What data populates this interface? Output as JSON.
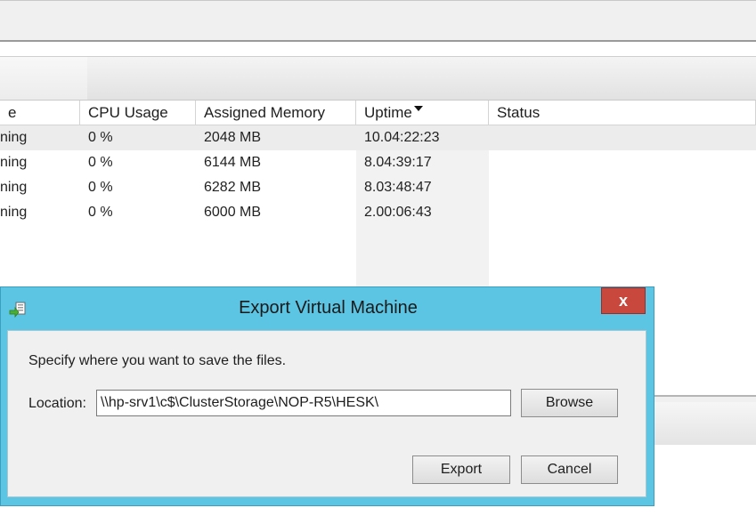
{
  "vm_list": {
    "columns": [
      {
        "label": "e"
      },
      {
        "label": "CPU Usage"
      },
      {
        "label": "Assigned Memory"
      },
      {
        "label": "Uptime"
      },
      {
        "label": "Status"
      }
    ],
    "sort_column": "Uptime",
    "rows": [
      {
        "state": "ning",
        "cpu": "0 %",
        "memory": "2048 MB",
        "uptime": "10.04:22:23",
        "status": ""
      },
      {
        "state": "ning",
        "cpu": "0 %",
        "memory": "6144 MB",
        "uptime": "8.04:39:17",
        "status": ""
      },
      {
        "state": "ning",
        "cpu": "0 %",
        "memory": "6282 MB",
        "uptime": "8.03:48:47",
        "status": ""
      },
      {
        "state": "ning",
        "cpu": "0 %",
        "memory": "6000 MB",
        "uptime": "2.00:06:43",
        "status": ""
      }
    ]
  },
  "dialog": {
    "title": "Export Virtual Machine",
    "close_glyph": "x",
    "prompt": "Specify where you want to save the files.",
    "location_label": "Location:",
    "location_value": "\\\\hp-srv1\\c$\\ClusterStorage\\NOP-R5\\HESK\\",
    "browse_label": "Browse",
    "export_label": "Export",
    "cancel_label": "Cancel",
    "icon": "export-vm-icon"
  },
  "colors": {
    "dialog_frame": "#5cc5e3",
    "close_button": "#c8483d",
    "selected_row": "#ececec"
  }
}
